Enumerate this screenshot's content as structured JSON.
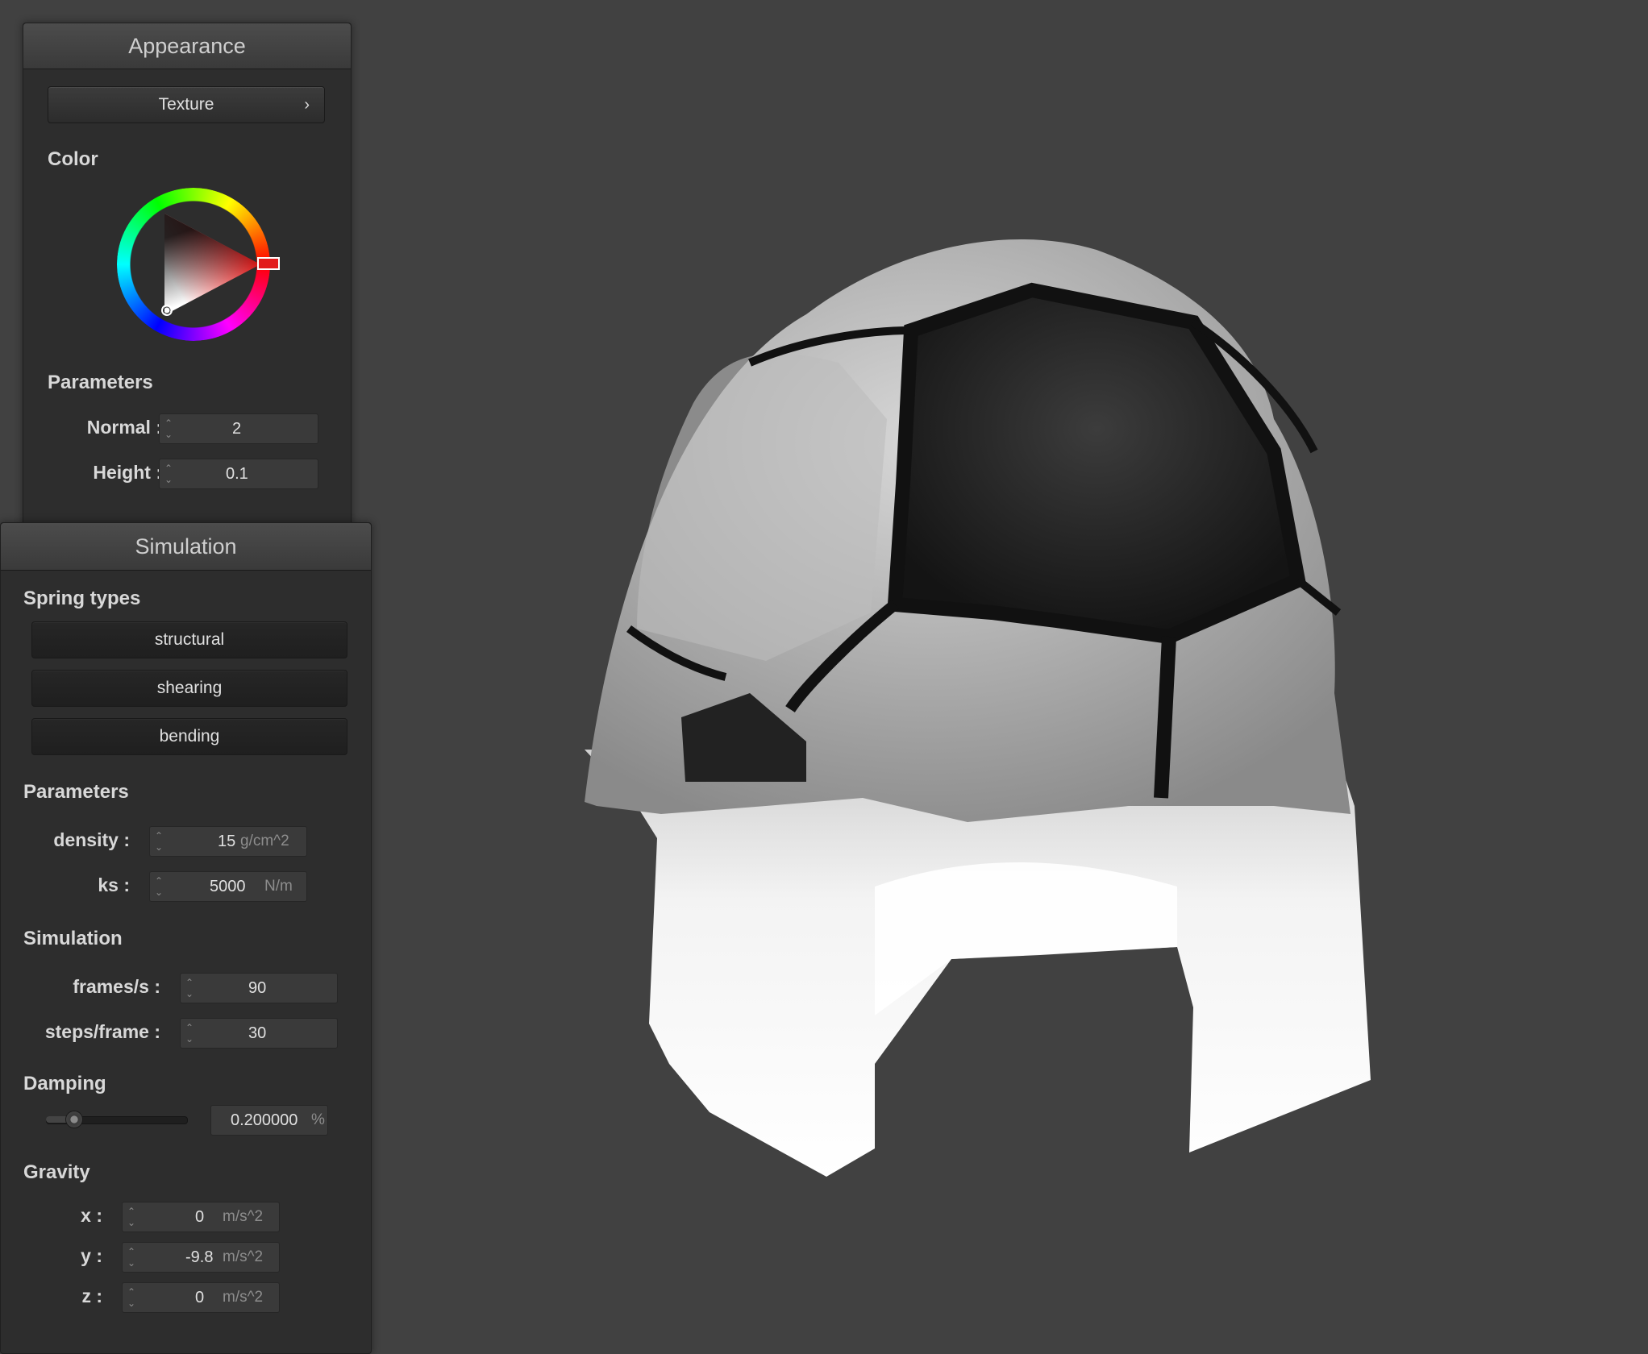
{
  "appearance": {
    "title": "Appearance",
    "texture_button": "Texture",
    "color_label": "Color",
    "parameters_label": "Parameters",
    "normal": {
      "label": "Normal :",
      "value": "2"
    },
    "height": {
      "label": "Height :",
      "value": "0.1"
    },
    "selected_color": "#ff2a2a"
  },
  "simulation": {
    "title": "Simulation",
    "spring_types_label": "Spring types",
    "springs": [
      "structural",
      "shearing",
      "bending"
    ],
    "parameters_label": "Parameters",
    "density": {
      "label": "density :",
      "value": "15",
      "unit": "g/cm^2"
    },
    "ks": {
      "label": "ks :",
      "value": "5000",
      "unit": "N/m"
    },
    "simulation_label": "Simulation",
    "fps": {
      "label": "frames/s :",
      "value": "90"
    },
    "steps": {
      "label": "steps/frame :",
      "value": "30"
    },
    "damping_label": "Damping",
    "damping": {
      "value": "0.200000",
      "unit": "%",
      "slider_level": 0.2
    },
    "gravity_label": "Gravity",
    "gravity": [
      {
        "label": "x :",
        "value": "0",
        "unit": "m/s^2"
      },
      {
        "label": "y :",
        "value": "-9.8",
        "unit": "m/s^2"
      },
      {
        "label": "z :",
        "value": "0",
        "unit": "m/s^2"
      }
    ]
  },
  "viewport": {
    "background": "#414141",
    "object": "cloth-draped-over-sphere",
    "texture": "soccer-ball-pattern"
  }
}
